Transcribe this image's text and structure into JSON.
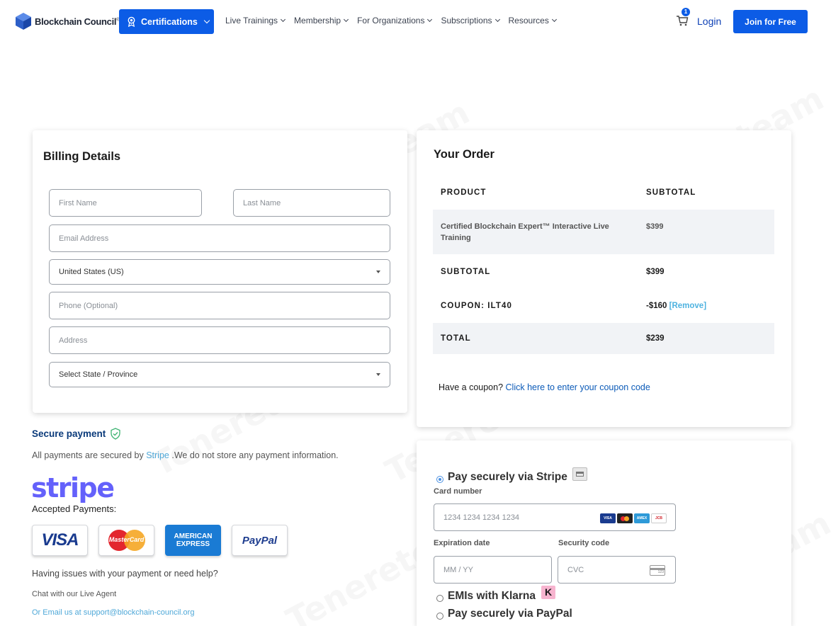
{
  "header": {
    "logo_text": "Blockchain Council",
    "logo_mark": "®",
    "certifications_label": "Certifications",
    "nav": [
      "Live Trainings",
      "Membership",
      "For Organizations",
      "Subscriptions",
      "Resources"
    ],
    "cart_count": "1",
    "login_label": "Login",
    "join_label": "Join for Free"
  },
  "billing": {
    "title": "Billing Details",
    "first_name_placeholder": "First Name",
    "last_name_placeholder": "Last Name",
    "email_placeholder": "Email Address",
    "country_value": "United States (US)",
    "phone_placeholder": "Phone (Optional)",
    "address_placeholder": "Address",
    "state_value": "Select State / Province"
  },
  "order": {
    "title": "Your Order",
    "col_product": "PRODUCT",
    "col_subtotal": "SUBTOTAL",
    "product_name": "Certified Blockchain Expert™ Interactive Live Training",
    "product_price": "$399",
    "subtotal_label": "SUBTOTAL",
    "subtotal_value": "$399",
    "coupon_label": "COUPON: ILT40",
    "coupon_value": "-$160",
    "remove_label": "[Remove]",
    "total_label": "TOTAL",
    "total_value": "$239",
    "have_coupon": "Have a coupon?",
    "coupon_link": "Click here to enter your coupon code"
  },
  "secure": {
    "title": "Secure payment",
    "text_before": "All payments are secured by",
    "stripe_link": "Stripe",
    "text_after": ".We do not store any payment information.",
    "stripe_logo": "stripe",
    "accepted": "Accepted Payments:",
    "visa": "VISA",
    "mastercard": "MasterCard",
    "amex_line1": "AMERICAN",
    "amex_line2": "EXPRESS",
    "paypal": "PayPal",
    "issues": "Having issues with your payment or need help?",
    "chat": "Chat with our Live Agent",
    "email": "Or Email us at support@blockchain-council.org"
  },
  "payment": {
    "stripe_label": "Pay securely via Stripe",
    "card_number_label": "Card number",
    "card_number_placeholder": "1234 1234 1234 1234",
    "expiration_label": "Expiration date",
    "expiration_placeholder": "MM / YY",
    "security_label": "Security code",
    "cvc_placeholder": "CVC",
    "mini_visa": "VISA",
    "mini_amex": "AMEX",
    "mini_jcb": "JCB",
    "cvc_icon_text": "123",
    "klarna_label": "EMIs with Klarna",
    "klarna_logo": "K",
    "paypal_label": "Pay securely via PayPal"
  },
  "watermark": "Tenereteam",
  "colors": {
    "primary": "#0c5ce6",
    "stripe": "#6461fb",
    "link": "#0c5bb8",
    "light_link": "#4fa8d8"
  }
}
